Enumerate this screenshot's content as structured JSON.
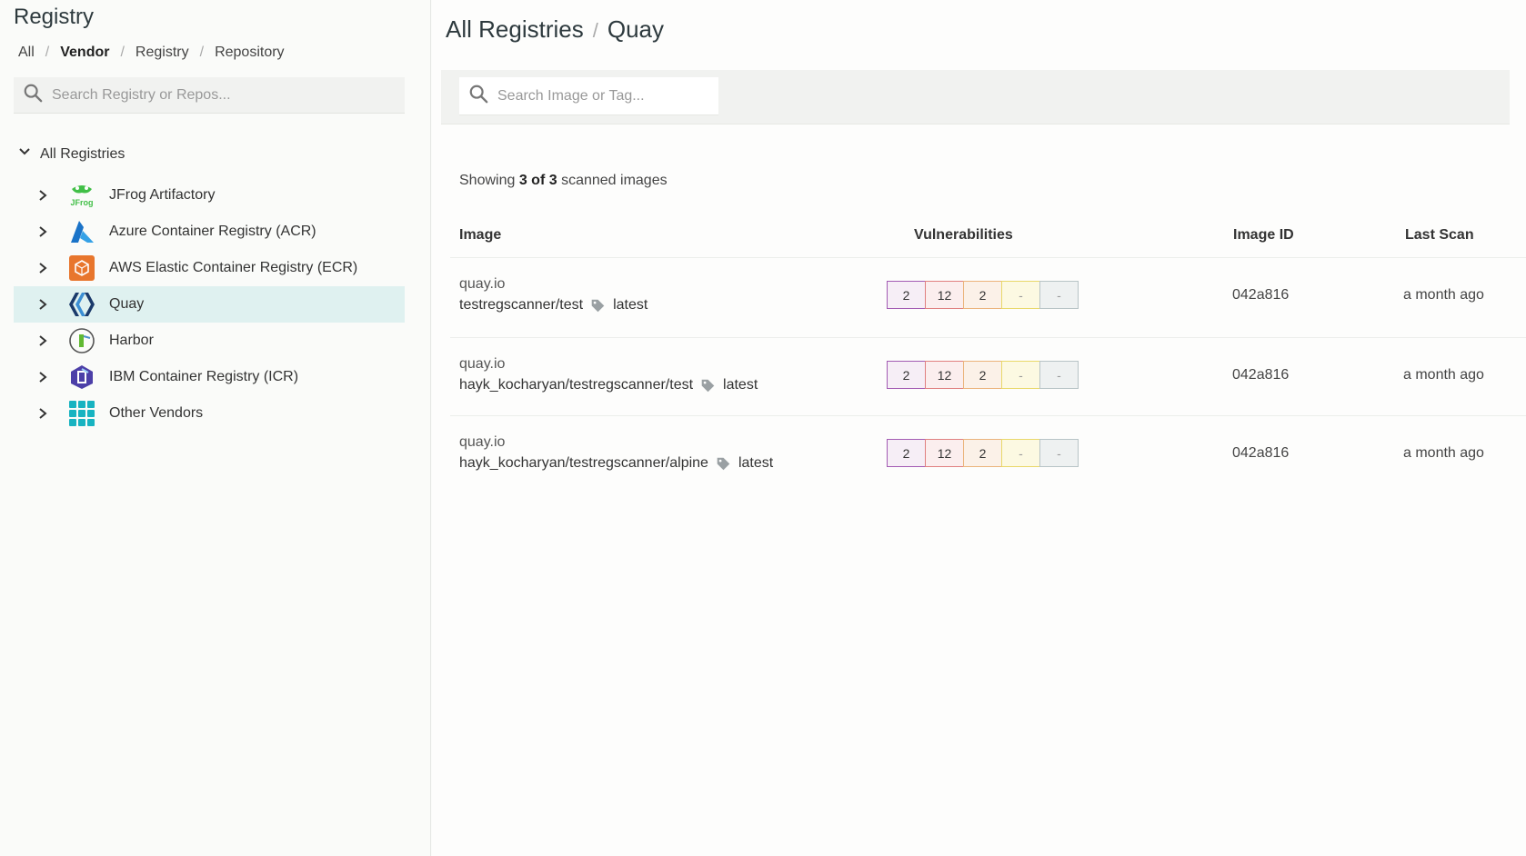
{
  "sidebar": {
    "title": "Registry",
    "breadcrumb": [
      "All",
      "Vendor",
      "Registry",
      "Repository"
    ],
    "search_placeholder": "Search Registry or Repos...",
    "root_label": "All Registries",
    "items": [
      {
        "label": "JFrog Artifactory",
        "icon": "jfrog-logo-icon",
        "selected": false
      },
      {
        "label": "Azure Container Registry (ACR)",
        "icon": "azure-logo-icon",
        "selected": false
      },
      {
        "label": "AWS Elastic Container Registry (ECR)",
        "icon": "aws-logo-icon",
        "selected": false
      },
      {
        "label": "Quay",
        "icon": "quay-logo-icon",
        "selected": true
      },
      {
        "label": "Harbor",
        "icon": "harbor-logo-icon",
        "selected": false
      },
      {
        "label": "IBM Container Registry (ICR)",
        "icon": "ibm-logo-icon",
        "selected": false
      },
      {
        "label": "Other Vendors",
        "icon": "grid-icon",
        "selected": false
      }
    ]
  },
  "main": {
    "breadcrumb_root": "All Registries",
    "breadcrumb_current": "Quay",
    "search_placeholder": "Search Image or Tag...",
    "showing_prefix": "Showing",
    "showing_count": "3 of 3",
    "showing_suffix": "scanned images",
    "columns": {
      "image": "Image",
      "vulnerabilities": "Vulnerabilities",
      "image_id": "Image ID",
      "last_scan": "Last Scan"
    },
    "rows": [
      {
        "registry": "quay.io",
        "name": "testregscanner/test",
        "tag": "latest",
        "vulns": {
          "critical": "2",
          "high": "12",
          "medium": "2",
          "low": "-",
          "negligible": "-"
        },
        "image_id": "042a816",
        "last_scan": "a month ago"
      },
      {
        "registry": "quay.io",
        "name": "hayk_kocharyan/testregscanner/test",
        "tag": "latest",
        "vulns": {
          "critical": "2",
          "high": "12",
          "medium": "2",
          "low": "-",
          "negligible": "-"
        },
        "image_id": "042a816",
        "last_scan": "a month ago"
      },
      {
        "registry": "quay.io",
        "name": "hayk_kocharyan/testregscanner/alpine",
        "tag": "latest",
        "vulns": {
          "critical": "2",
          "high": "12",
          "medium": "2",
          "low": "-",
          "negligible": "-"
        },
        "image_id": "042a816",
        "last_scan": "a month ago"
      }
    ]
  },
  "colors": {
    "selected_bg": "#dff1f0",
    "critical": "#a35bb3",
    "high": "#e08080",
    "medium": "#ebb47c",
    "low": "#e9d86a",
    "negligible": "#b8c4c6"
  }
}
